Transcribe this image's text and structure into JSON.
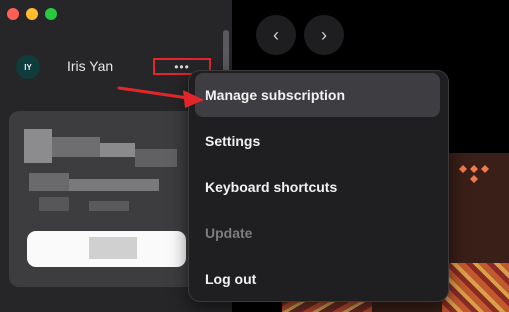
{
  "window": {
    "controls": [
      "close",
      "minimize",
      "zoom"
    ]
  },
  "user": {
    "initials": "IY",
    "name": "Iris Yan",
    "more_label": "•••"
  },
  "nav": {
    "back_icon": "chevron-left-icon",
    "forward_icon": "chevron-right-icon",
    "back_glyph": "‹",
    "forward_glyph": "›"
  },
  "menu": {
    "items": [
      {
        "label": "Manage subscription",
        "state": "hover"
      },
      {
        "label": "Settings",
        "state": "normal"
      },
      {
        "label": "Keyboard shortcuts",
        "state": "normal"
      },
      {
        "label": "Update",
        "state": "disabled"
      },
      {
        "label": "Log out",
        "state": "normal"
      }
    ]
  },
  "annotation": {
    "highlight_color": "#e3262b",
    "arrow_color": "#e3262b"
  },
  "colors": {
    "sidebar": "#262628",
    "menu": "#1f1f22",
    "menu_hover": "#3e3e42"
  }
}
